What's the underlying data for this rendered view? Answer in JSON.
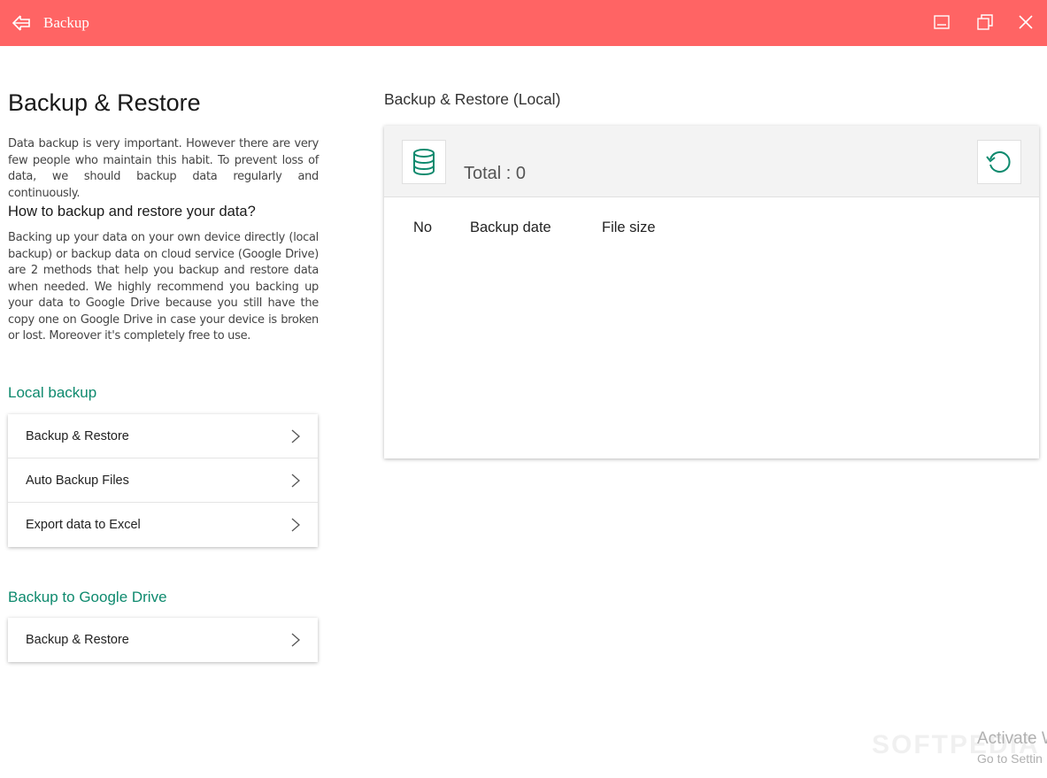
{
  "window": {
    "title": "Backup",
    "accent_color": "#ff6464",
    "icons": {
      "back": "arrow-left-icon",
      "minimize": "minimize-icon",
      "maximize": "restore-window-icon",
      "close": "close-icon"
    }
  },
  "left": {
    "page_title": "Backup & Restore",
    "intro": "Data backup is very important. However there are very few people who maintain this habit. To prevent loss of data, we should backup data regularly and continuously.",
    "howto_title": "How to backup and restore your data?",
    "howto_text": "Backing up your data on your own device directly (local backup) or backup data on cloud service (Google Drive) are 2 methods that help you backup and restore data when needed. We highly recommend you backing up your data to Google Drive because you still have the copy one on Google Drive in case your device is broken or lost. Moreover it's completely free to use.",
    "section_color": "#0e8a6e",
    "local_label": "Local backup",
    "local_items": [
      {
        "label": "Backup & Restore"
      },
      {
        "label": "Auto Backup Files"
      },
      {
        "label": "Export data to Excel"
      }
    ],
    "gdrive_label": "Backup to Google Drive",
    "gdrive_items": [
      {
        "label": "Backup & Restore"
      }
    ]
  },
  "right": {
    "title": "Backup & Restore (Local)",
    "total_text": "Total : 0",
    "icons": {
      "database": "database-icon",
      "refresh": "refresh-icon"
    },
    "columns": [
      "No",
      "Backup date",
      "File size"
    ]
  },
  "overlay": {
    "watermark": "SOFTPEDIA",
    "activate_title": "Activate W",
    "activate_sub": "Go to Settin"
  }
}
